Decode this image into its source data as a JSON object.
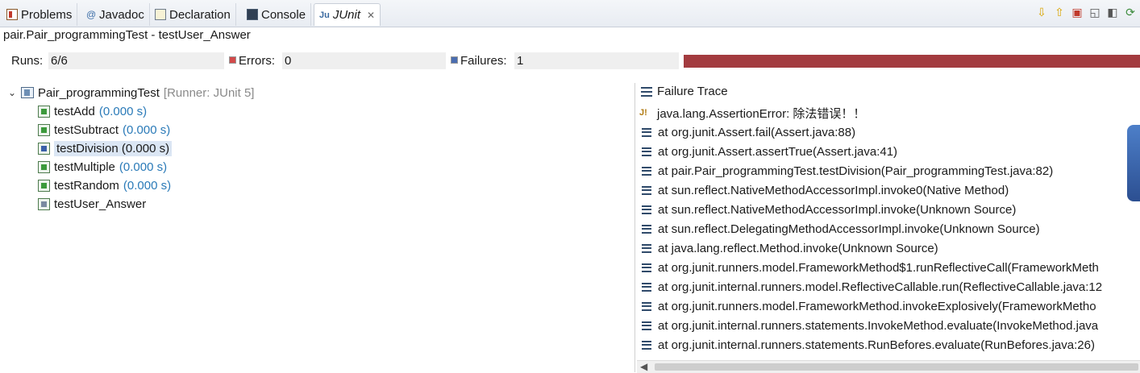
{
  "tabs": [
    {
      "label": "Problems",
      "icon": "problems-icon"
    },
    {
      "label": "Javadoc",
      "icon": "javadoc-icon"
    },
    {
      "label": "Declaration",
      "icon": "declaration-icon"
    },
    {
      "label": "Console",
      "icon": "console-icon"
    },
    {
      "label": "JUnit",
      "icon": "junit-icon",
      "active": true
    }
  ],
  "status_line": "pair.Pair_programmingTest - testUser_Answer",
  "counters": {
    "runs_label": "Runs:",
    "runs_value": "6/6",
    "errors_label": "Errors:",
    "errors_value": "0",
    "failures_label": "Failures:",
    "failures_value": "1"
  },
  "progress": {
    "fraction": 1.0,
    "color": "#a33b3f"
  },
  "tree": {
    "suite_name": "Pair_programmingTest",
    "suite_runner": "[Runner: JUnit 5]",
    "tests": [
      {
        "name": "testAdd",
        "time": "(0.000 s)",
        "status": "pass"
      },
      {
        "name": "testSubtract",
        "time": "(0.000 s)",
        "status": "pass"
      },
      {
        "name": "testDivision",
        "time": "(0.000 s)",
        "status": "fail"
      },
      {
        "name": "testMultiple",
        "time": "(0.000 s)",
        "status": "pass"
      },
      {
        "name": "testRandom",
        "time": "(0.000 s)",
        "status": "pass"
      },
      {
        "name": "testUser_Answer",
        "time": "",
        "status": "running"
      }
    ]
  },
  "trace": {
    "header": "Failure Trace",
    "lines": [
      "java.lang.AssertionError: 除法错误！！",
      "at org.junit.Assert.fail(Assert.java:88)",
      "at org.junit.Assert.assertTrue(Assert.java:41)",
      "at pair.Pair_programmingTest.testDivision(Pair_programmingTest.java:82)",
      "at sun.reflect.NativeMethodAccessorImpl.invoke0(Native Method)",
      "at sun.reflect.NativeMethodAccessorImpl.invoke(Unknown Source)",
      "at sun.reflect.DelegatingMethodAccessorImpl.invoke(Unknown Source)",
      "at java.lang.reflect.Method.invoke(Unknown Source)",
      "at org.junit.runners.model.FrameworkMethod$1.runReflectiveCall(FrameworkMeth",
      "at org.junit.internal.runners.model.ReflectiveCallable.run(ReflectiveCallable.java:12",
      "at org.junit.runners.model.FrameworkMethod.invokeExplosively(FrameworkMetho",
      "at org.junit.internal.runners.statements.InvokeMethod.evaluate(InvokeMethod.java",
      "at org.junit.internal.runners.statements.RunBefores.evaluate(RunBefores.java:26)"
    ]
  }
}
